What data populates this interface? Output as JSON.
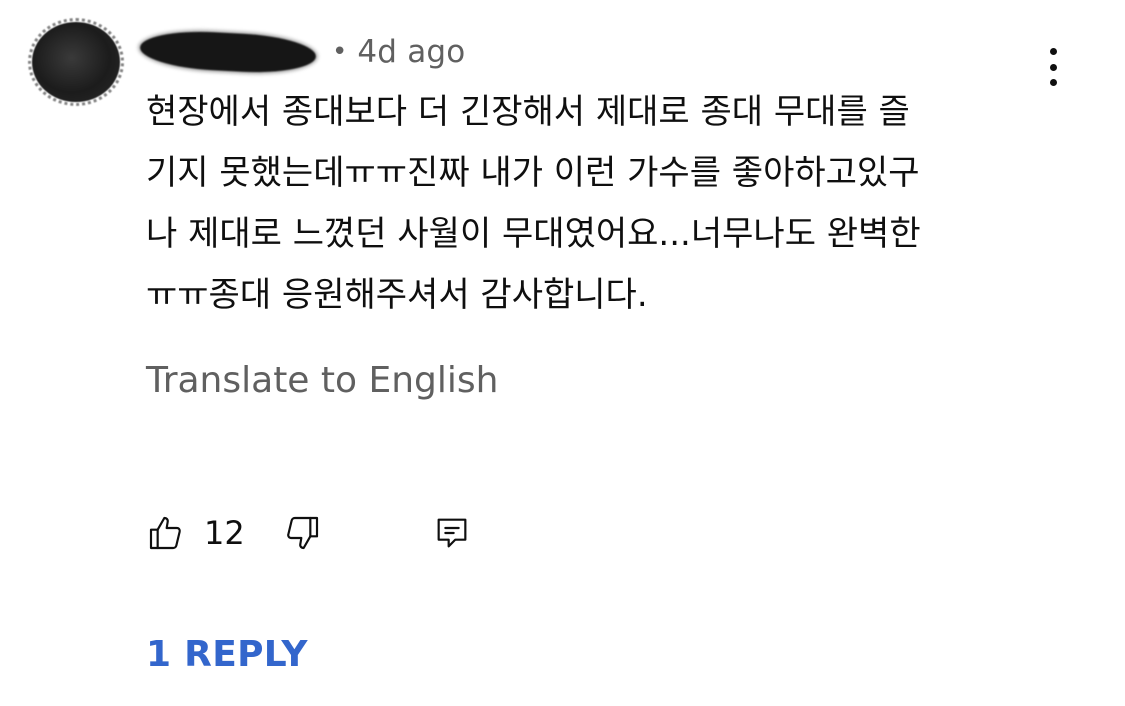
{
  "comment": {
    "timestamp": "4d ago",
    "separator": "•",
    "text_lines": [
      "현장에서 종대보다 더 긴장해서 제대로 종대 무대를 즐",
      "기지 못했는데ㅠㅠ진짜 내가 이런 가수를 좋아하고있구",
      "나 제대로 느꼈던 사월이 무대였어요...너무나도 완벽한",
      "ㅠㅠ종대 응원해주셔서 감사합니다."
    ],
    "translate_label": "Translate to English",
    "like_count": "12",
    "replies_label": "1 REPLY"
  },
  "icons": {
    "menu": "more-vert-icon",
    "like": "thumb-up-icon",
    "dislike": "thumb-down-icon",
    "reply": "comment-icon"
  },
  "colors": {
    "text": "#0f0f0f",
    "secondary": "#606060",
    "link": "#3366cc"
  }
}
